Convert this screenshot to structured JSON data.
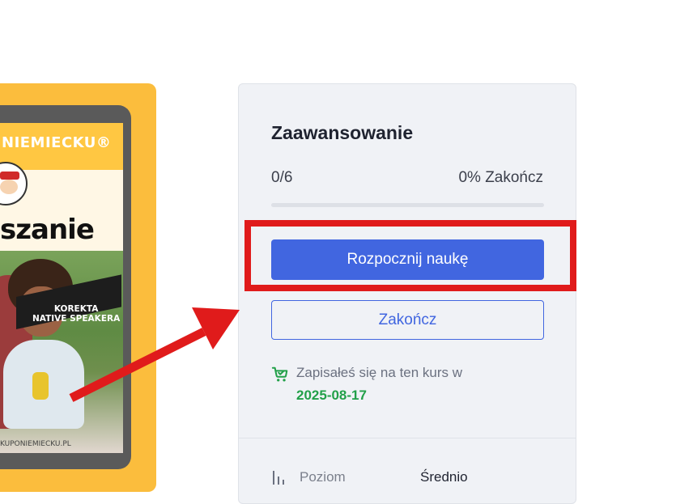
{
  "cover": {
    "brand": "NIEMIECKU®",
    "title": "szanie",
    "badge_line1": "KOREKTA",
    "badge_line2": "NATIVE SPEAKERA",
    "url": "KUPONIEMIECKU.PL"
  },
  "sidebar": {
    "title": "Zaawansowanie",
    "progress_count": "0/6",
    "progress_percent_label": "0% Zakończ",
    "progress_value": 0,
    "start_button": "Rozpocznij naukę",
    "finish_button": "Zakończ",
    "enrolled_text": "Zapisałeś się na ten kurs w",
    "enrolled_date": "2025-08-17",
    "level_label": "Poziom",
    "level_value": "Średnio"
  },
  "colors": {
    "primary": "#4166e0",
    "highlight": "#e01b1b",
    "success": "#22a049",
    "cover_bg": "#fbbd3d"
  },
  "icons": {
    "enroll": "cart-check-icon",
    "level": "bar-chart-icon"
  }
}
